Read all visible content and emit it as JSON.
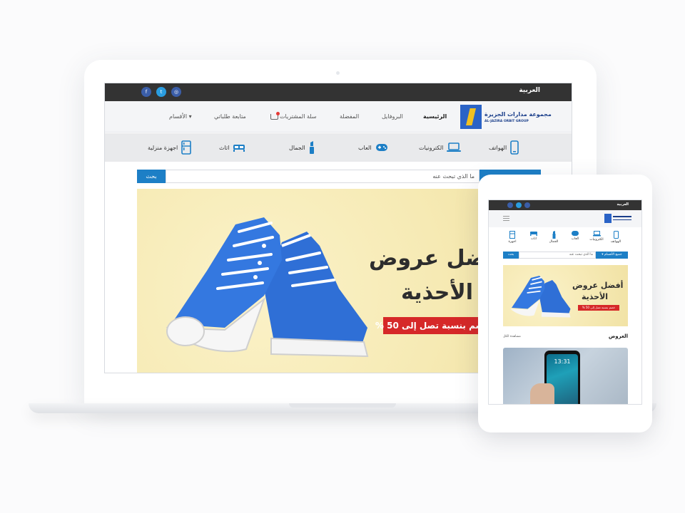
{
  "colors": {
    "accent": "#1d7fc6",
    "topbar": "#333333",
    "promo": "#d62828",
    "banner_bg": "#f6eab4",
    "shoe": "#2f6fd6"
  },
  "desktop": {
    "topbar": {
      "language": "العربية",
      "social": [
        "f",
        "t",
        "◎"
      ]
    },
    "logo": {
      "ar": "مجموعة مدارات الجزيرة",
      "en": "AL-JAZIRA ORBIT GROUP"
    },
    "nav": {
      "home": "الرئيسية",
      "profile": "البروفايل",
      "favorites": "المفضلة",
      "cart": "سلة المشتريات",
      "orders": "متابعة طلباتي",
      "sections": "الأقسام ▾"
    },
    "categories": [
      "الهواتف",
      "الكترونيات",
      "العاب",
      "الجمال",
      "اثاث",
      "اجهزة منزلية"
    ],
    "search": {
      "button": "بحث",
      "placeholder": "ما الذي تبحث عنه"
    },
    "banner": {
      "title_line1": "أفضل عروض",
      "title_line2": "الأحذية",
      "promo": "خصم بنسبة تصل إلى 50 %"
    }
  },
  "tablet": {
    "topbar": {
      "language": "العربية"
    },
    "categories": [
      "الهواتف",
      "الكترونيات",
      "العاب",
      "الجمال",
      "اثاث",
      "اجهزة"
    ],
    "search": {
      "button": "بحث",
      "placeholder": "ما الذي تبحث عنه",
      "category": "جميع الأقسام ▾"
    },
    "banner": {
      "title_line1": "أفضل عروض",
      "title_line2": "الأحذية",
      "promo": "خصم بنسبة تصل إلى 50 %"
    },
    "section": {
      "title": "العروض",
      "link": "مشاهدة الكل"
    },
    "offer": {
      "time": "13:31"
    }
  }
}
